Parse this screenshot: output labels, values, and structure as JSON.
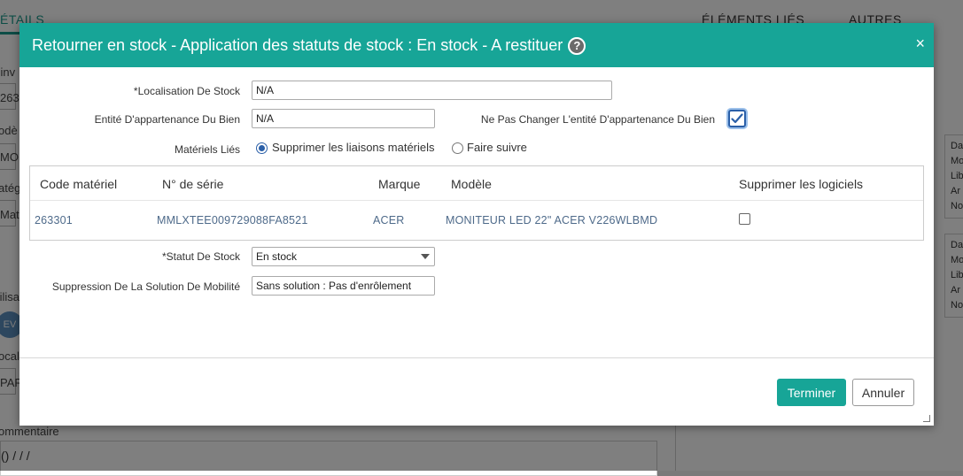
{
  "background": {
    "tab_left": "ÉTAILS",
    "tab_right_1": "ÉLÉMENTS LIÉS",
    "tab_right_2": "AUTRES",
    "frag_inv": "'inv",
    "frag_263": "263",
    "frag_mode": "odè",
    "frag_mo": "MO",
    "frag_categ": "atég",
    "frag_mat": "Mat",
    "frag_util": "tilisa",
    "avatar": "EV",
    "frag_local": "ocal",
    "frag_par": "PAR",
    "frag_comment_label": "ommentaire",
    "frag_comment_value": "() / / /",
    "card1": [
      "Da",
      "Mo",
      "Lib",
      "Ar",
      "No"
    ],
    "card2": [
      "Da",
      "Mo",
      "Lib",
      "Ar",
      "No"
    ]
  },
  "modal": {
    "title": "Retourner en stock - Application des statuts de stock : En stock - A restituer",
    "help_icon": "?",
    "close_icon": "×",
    "localisation_label": "*Localisation De Stock",
    "localisation_value": "N/A",
    "entite_label": "Entité D'appartenance Du Bien",
    "entite_value": "N/A",
    "ne_pas_changer_label": "Ne Pas Changer L'entité D'appartenance Du Bien",
    "ne_pas_changer_checked": true,
    "materiels_lies_label": "Matériels Liés",
    "radio_supprimer": "Supprimer les liaisons matériels",
    "radio_faire_suivre": "Faire suivre",
    "table": {
      "headers": [
        "Code matériel",
        "N° de série",
        "Marque",
        "Modèle",
        "Supprimer les logiciels"
      ],
      "rows": [
        {
          "code": "263301",
          "serie": "MMLXTEE009729088FA8521",
          "marque": "ACER",
          "modele": "MONITEUR LED 22\" ACER V226WLBMD",
          "supprimer_logiciels": false
        }
      ]
    },
    "statut_label": "*Statut De Stock",
    "statut_value": "En stock",
    "suppression_label": "Suppression De La Solution De Mobilité",
    "suppression_value": "Sans solution : Pas d'enrôlement",
    "terminer": "Terminer",
    "annuler": "Annuler"
  },
  "colors": {
    "accent": "#17a597",
    "checkbox": "#2a5fa8",
    "table_text": "#4e6a8a"
  }
}
